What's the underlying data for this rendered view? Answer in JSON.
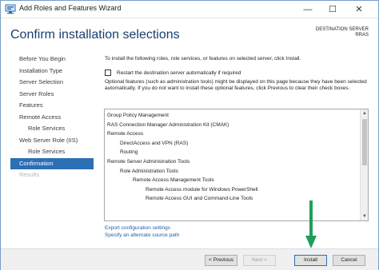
{
  "window": {
    "title": "Add Roles and Features Wizard",
    "controls": {
      "minimize": "—",
      "maximize": "☐",
      "close": "✕"
    }
  },
  "header": {
    "title": "Confirm installation selections",
    "destination_label": "DESTINATION SERVER",
    "destination_value": "RRAS"
  },
  "nav": {
    "items": [
      {
        "label": "Before You Begin",
        "state": "normal",
        "level": 0
      },
      {
        "label": "Installation Type",
        "state": "normal",
        "level": 0
      },
      {
        "label": "Server Selection",
        "state": "normal",
        "level": 0
      },
      {
        "label": "Server Roles",
        "state": "normal",
        "level": 0
      },
      {
        "label": "Features",
        "state": "normal",
        "level": 0
      },
      {
        "label": "Remote Access",
        "state": "normal",
        "level": 0
      },
      {
        "label": "Role Services",
        "state": "normal",
        "level": 1
      },
      {
        "label": "Web Server Role (IIS)",
        "state": "normal",
        "level": 0
      },
      {
        "label": "Role Services",
        "state": "normal",
        "level": 1
      },
      {
        "label": "Confirmation",
        "state": "active",
        "level": 0
      },
      {
        "label": "Results",
        "state": "disabled",
        "level": 0
      }
    ]
  },
  "content": {
    "intro": "To install the following roles, role services, or features on selected server, click Install.",
    "restart_label": "Restart the destination server automatically if required",
    "restart_checked": false,
    "optional_note": "Optional features (such as administration tools) might be displayed on this page because they have been selected automatically. If you do not want to install these optional features, click Previous to clear their check boxes.",
    "list": [
      {
        "text": "Group Policy Management",
        "level": 0
      },
      {
        "text": "RAS Connection Manager Administration Kit (CMAK)",
        "level": 0
      },
      {
        "text": "Remote Access",
        "level": 0
      },
      {
        "text": "DirectAccess and VPN (RAS)",
        "level": 1
      },
      {
        "text": "Routing",
        "level": 1
      },
      {
        "text": "Remote Server Administration Tools",
        "level": 0
      },
      {
        "text": "Role Administration Tools",
        "level": 1
      },
      {
        "text": "Remote Access Management Tools",
        "level": 2
      },
      {
        "text": "Remote Access module for Windows PowerShell",
        "level": 3
      },
      {
        "text": "Remote Access GUI and Command-Line Tools",
        "level": 3
      }
    ],
    "links": {
      "export": "Export configuration settings",
      "alternate_source": "Specify an alternate source path"
    }
  },
  "footer": {
    "previous": "< Previous",
    "next": "Next >",
    "install": "Install",
    "cancel": "Cancel"
  },
  "colors": {
    "accent": "#2b6fb4",
    "title": "#1a3f6f",
    "link": "#1f5fa6",
    "annotation_arrow": "#1f9e5a"
  },
  "icons": {
    "app": "server-manager-icon",
    "annotation": "green-down-arrow-icon"
  }
}
